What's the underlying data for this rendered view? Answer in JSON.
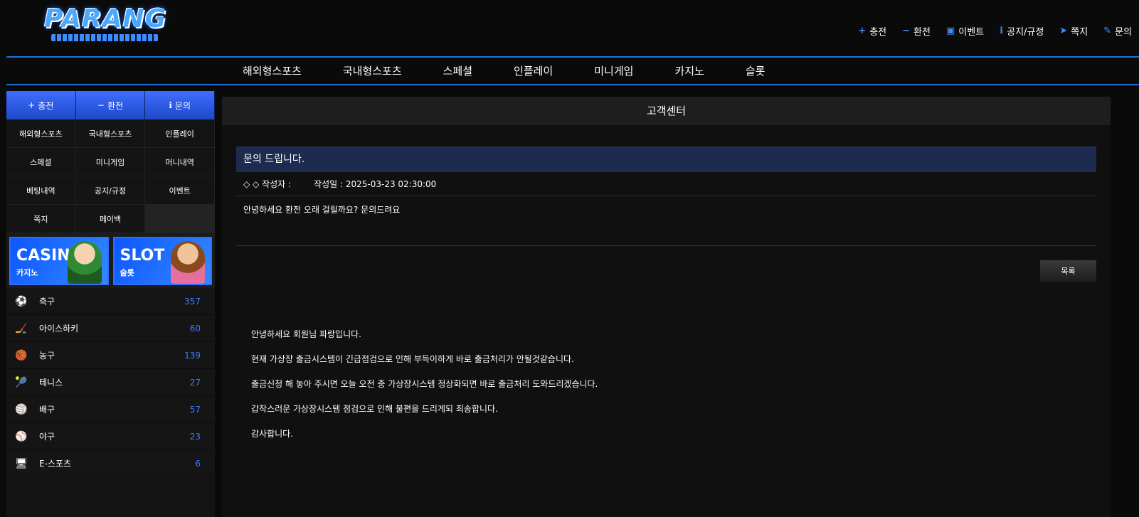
{
  "logo": {
    "word": "PARANG"
  },
  "top_nav": [
    {
      "icon": "plus-icon",
      "glyph": "+",
      "label": "충전"
    },
    {
      "icon": "minus-icon",
      "glyph": "−",
      "label": "환전"
    },
    {
      "icon": "calendar-icon",
      "glyph": "▣",
      "label": "이벤트"
    },
    {
      "icon": "info-icon",
      "glyph": "ℹ",
      "label": "공지/규정"
    },
    {
      "icon": "send-icon",
      "glyph": "➤",
      "label": "쪽지"
    },
    {
      "icon": "edit-icon",
      "glyph": "✎",
      "label": "문의"
    }
  ],
  "main_nav": [
    "해외형스포츠",
    "국내형스포츠",
    "스페셜",
    "인플레이",
    "미니게임",
    "카지노",
    "슬롯"
  ],
  "side_buttons": [
    {
      "glyph": "+",
      "label": "충전"
    },
    {
      "glyph": "−",
      "label": "환전"
    },
    {
      "glyph": "ℹ",
      "label": "문의"
    }
  ],
  "side_grid": [
    "해외형스포츠",
    "국내형스포츠",
    "인플레이",
    "스페셜",
    "미니게임",
    "머니내역",
    "베팅내역",
    "공지/규정",
    "이벤트",
    "쪽지",
    "페이백"
  ],
  "banners": [
    {
      "title": "CASINO",
      "subtitle": "카지노"
    },
    {
      "title": "SLOT",
      "subtitle": "슬롯"
    }
  ],
  "sports": [
    {
      "icon": "soccer-icon",
      "glyph": "⚽",
      "name": "축구",
      "count": "357"
    },
    {
      "icon": "hockey-icon",
      "glyph": "🏒",
      "name": "아이스하키",
      "count": "60"
    },
    {
      "icon": "basketball-icon",
      "glyph": "🏀",
      "name": "농구",
      "count": "139"
    },
    {
      "icon": "tennis-icon",
      "glyph": "🎾",
      "name": "테니스",
      "count": "27"
    },
    {
      "icon": "volleyball-icon",
      "glyph": "🏐",
      "name": "배구",
      "count": "57"
    },
    {
      "icon": "baseball-icon",
      "glyph": "⚾",
      "name": "야구",
      "count": "23"
    },
    {
      "icon": "esports-icon",
      "glyph": "🖥",
      "name": "E-스포츠",
      "count": "6"
    }
  ],
  "content": {
    "header": "고객센터",
    "post_title": "문의 드립니다.",
    "meta_prefix": "◇ ◇ 작성자 :",
    "meta_date": "작성일 : 2025-03-23 02:30:00",
    "body": "안녕하세요 환전 오래 걸릴까요? 문의드려요",
    "list_button": "목록",
    "answer": [
      "안녕하세요 회원님 파랑입니다.",
      "현재 가상장 출금시스템이 긴급점검으로 인해 부득이하게 바로 출금처리가 안될것같습니다.",
      "출금신청 해 놓아 주시면 오늘 오전 중 가상장시스템 정상화되면 바로 출금처리 도와드리겠습니다.",
      "갑작스러운 가상장시스템 점검으로 인해 불편을 드리게되 죄송합니다.",
      "감사합니다."
    ]
  }
}
